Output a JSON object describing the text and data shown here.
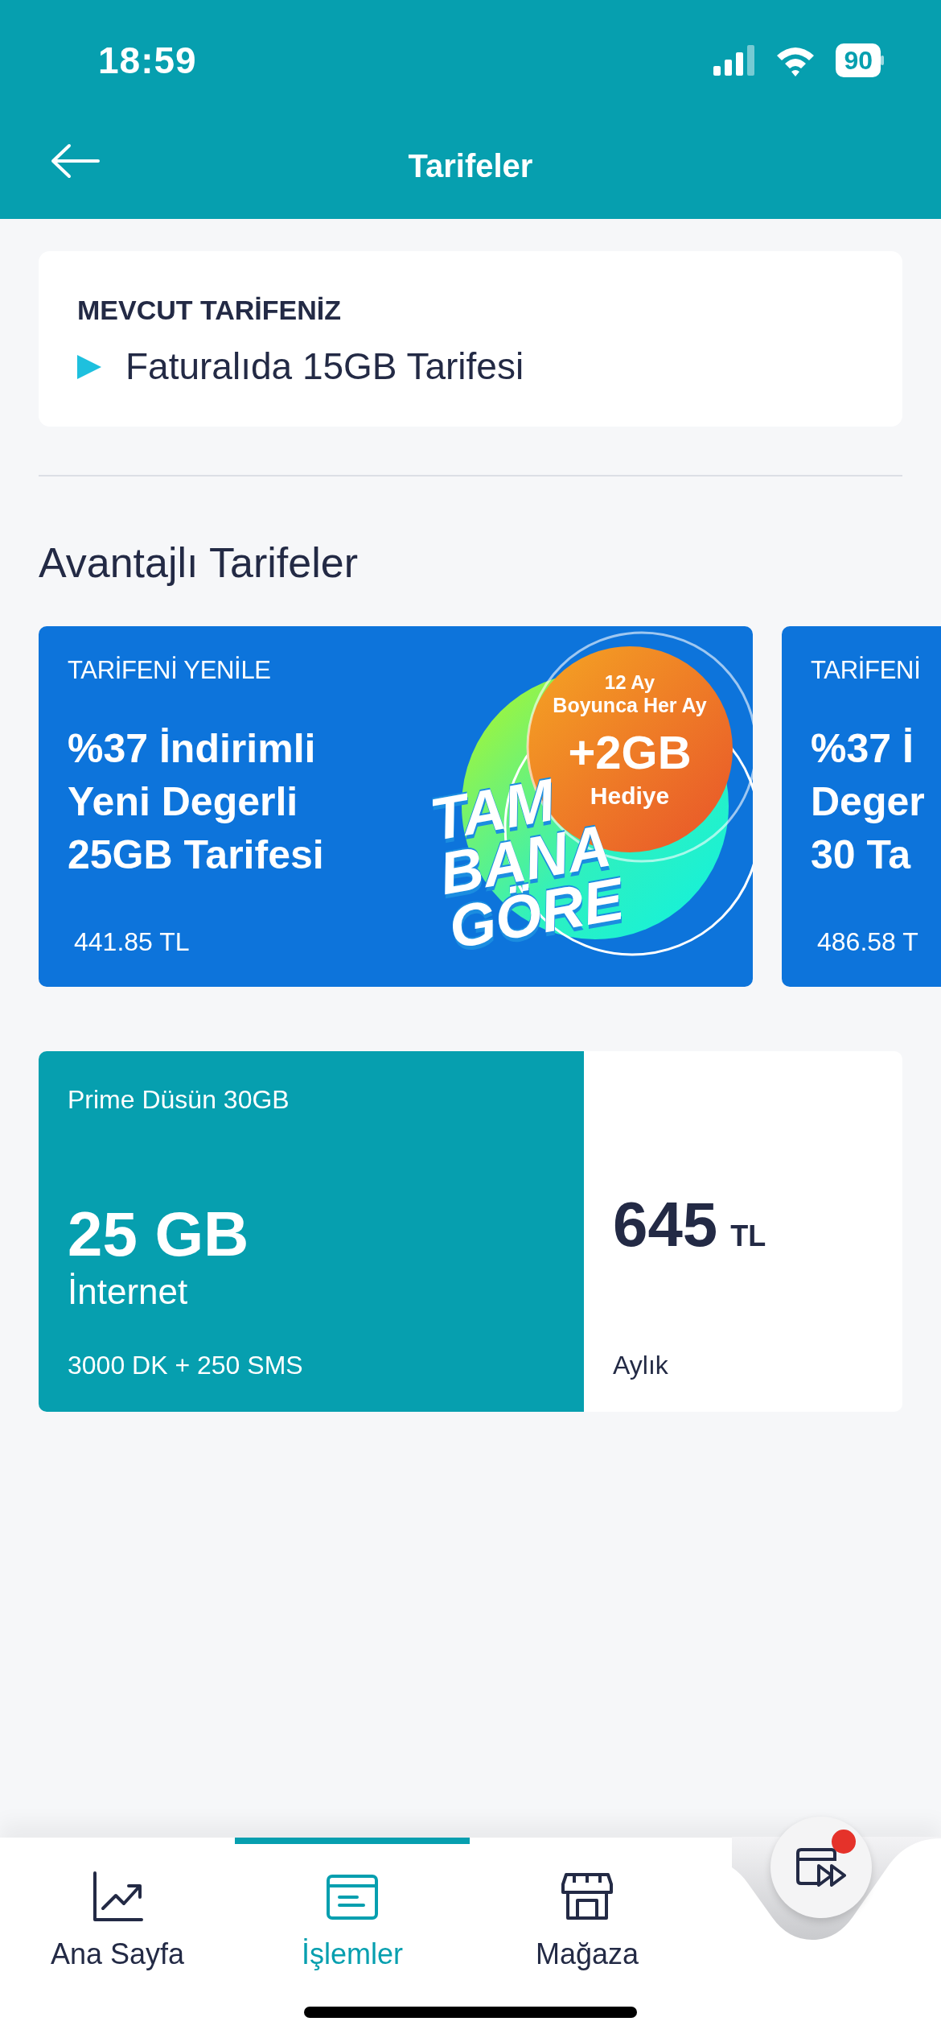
{
  "status_bar": {
    "time": "18:59",
    "battery": "90"
  },
  "header": {
    "title": "Tarifeler"
  },
  "current_tariff": {
    "label": "MEVCUT TARİFENİZ",
    "name": "Faturalıda 15GB Tarifesi"
  },
  "section_title": "Avantajlı Tarifeler",
  "offers": [
    {
      "tag": "TARİFENİ YENİLE",
      "title_lines": [
        "%37 İndirimli",
        "Yeni Degerli",
        "25GB Tarifesi"
      ],
      "price": "441.85 TL",
      "promo": {
        "badge_lines": [
          "12 Ay",
          "Boyunca Her Ay",
          "+2GB",
          "Hediye"
        ],
        "slogan_lines": [
          "TAM",
          "BANA",
          "GÖRE"
        ]
      }
    },
    {
      "tag": "TARİFENİ",
      "title_lines": [
        "%37 İ",
        "Deger",
        "30 Ta"
      ],
      "price": "486.58 T"
    }
  ],
  "plan": {
    "name": "Prime Düsün 30GB",
    "data": "25 GB",
    "data_label": "İnternet",
    "extras": "3000 DK + 250 SMS",
    "price": "645",
    "currency": "TL",
    "period": "Aylık"
  },
  "nav": {
    "tabs": [
      {
        "label": "Ana Sayfa",
        "kind": "chart",
        "selected": false
      },
      {
        "label": "İşlemler",
        "kind": "list",
        "selected": true
      },
      {
        "label": "Mağaza",
        "kind": "store",
        "selected": false
      }
    ],
    "fab": {
      "notification": true
    }
  }
}
